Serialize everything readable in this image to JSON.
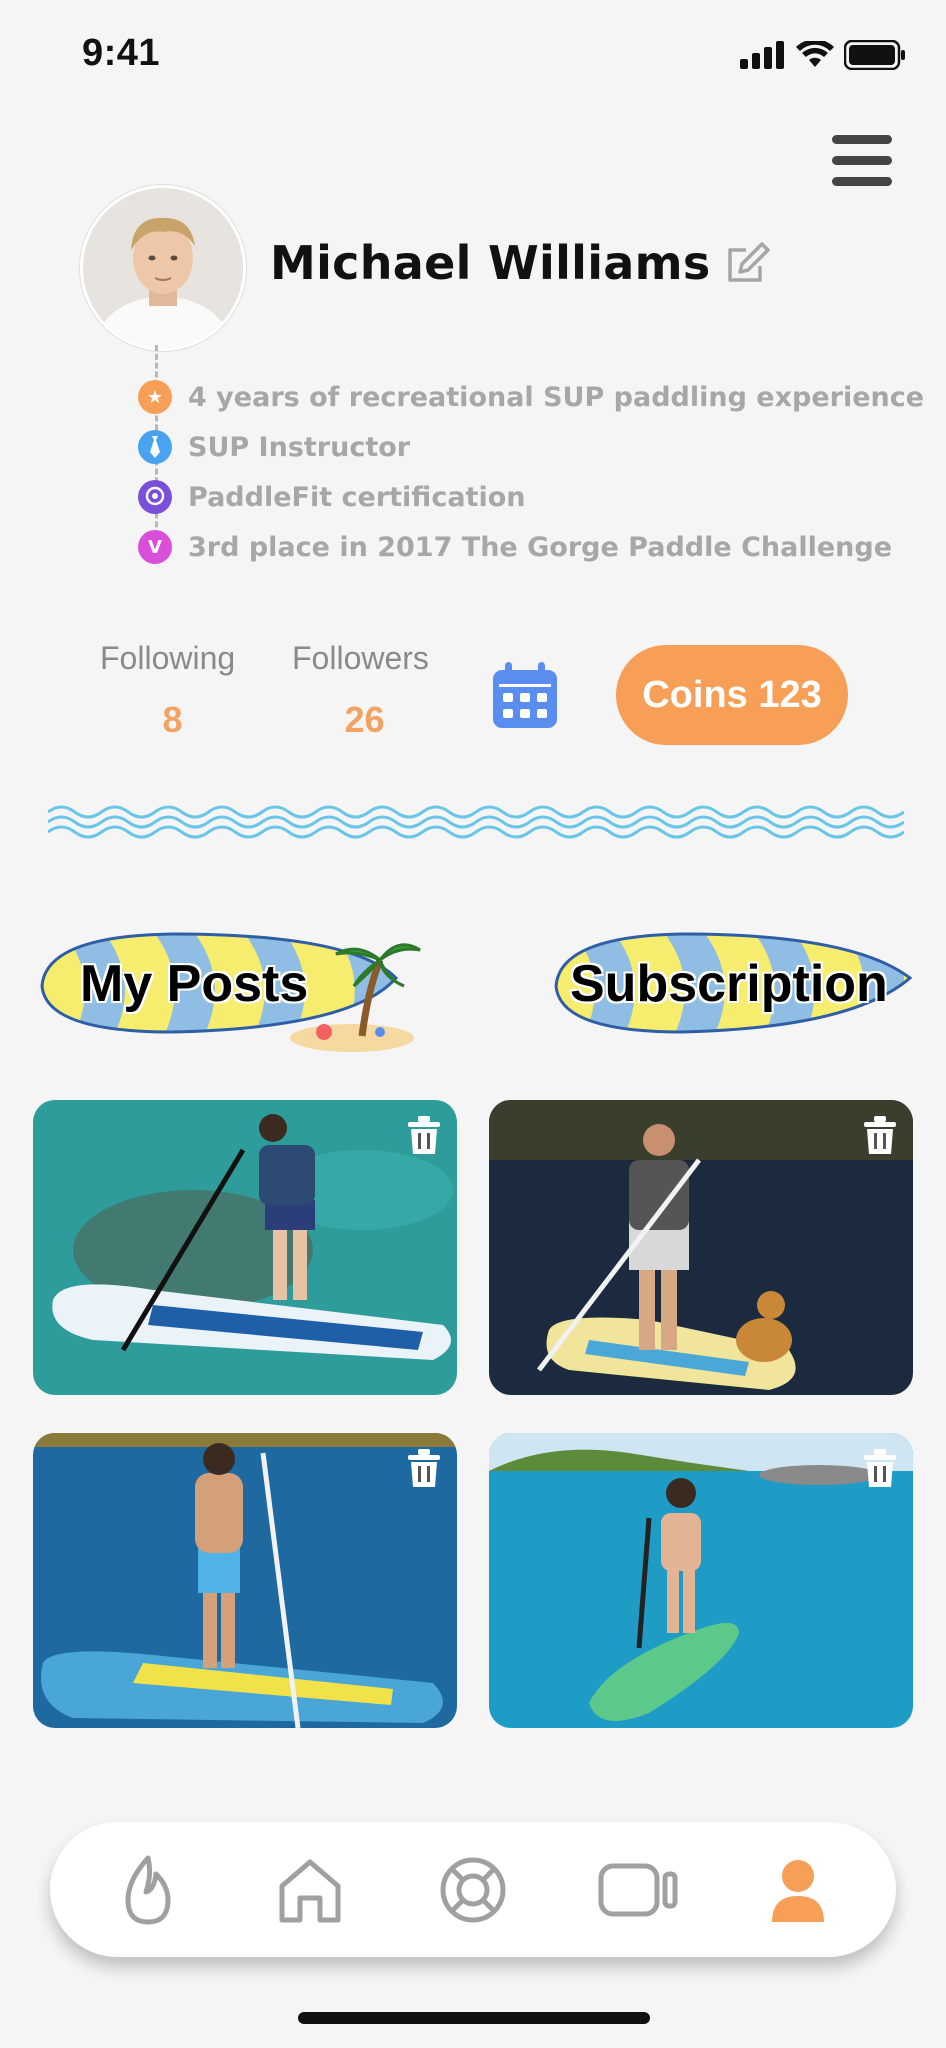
{
  "status_bar": {
    "time": "9:41"
  },
  "profile": {
    "name": "Michael Williams",
    "achievements": [
      {
        "text": "4 years of recreational SUP paddling experience",
        "color": "#f79f57",
        "icon": "star-icon"
      },
      {
        "text": "SUP Instructor",
        "color": "#4aa3f0",
        "icon": "tie-icon"
      },
      {
        "text": "PaddleFit certification",
        "color": "#7a4fd9",
        "icon": "badge-icon"
      },
      {
        "text": "3rd place in 2017 The Gorge Paddle Challenge",
        "color": "#d94fd9",
        "icon": "v-icon"
      }
    ]
  },
  "stats": {
    "following_label": "Following",
    "following_value": "8",
    "followers_label": "Followers",
    "followers_value": "26"
  },
  "coins_label": "Coins 123",
  "tabs": {
    "my_posts": "My Posts",
    "subscription": "Subscription"
  },
  "tab_bar": [
    {
      "icon": "flame-icon",
      "active": false
    },
    {
      "icon": "home-icon",
      "active": false
    },
    {
      "icon": "lifebuoy-icon",
      "active": false
    },
    {
      "icon": "video-icon",
      "active": false
    },
    {
      "icon": "profile-icon",
      "active": true
    }
  ],
  "colors": {
    "accent": "#f79f57",
    "inactive": "#a0a0a0",
    "calendar": "#5b8def"
  }
}
